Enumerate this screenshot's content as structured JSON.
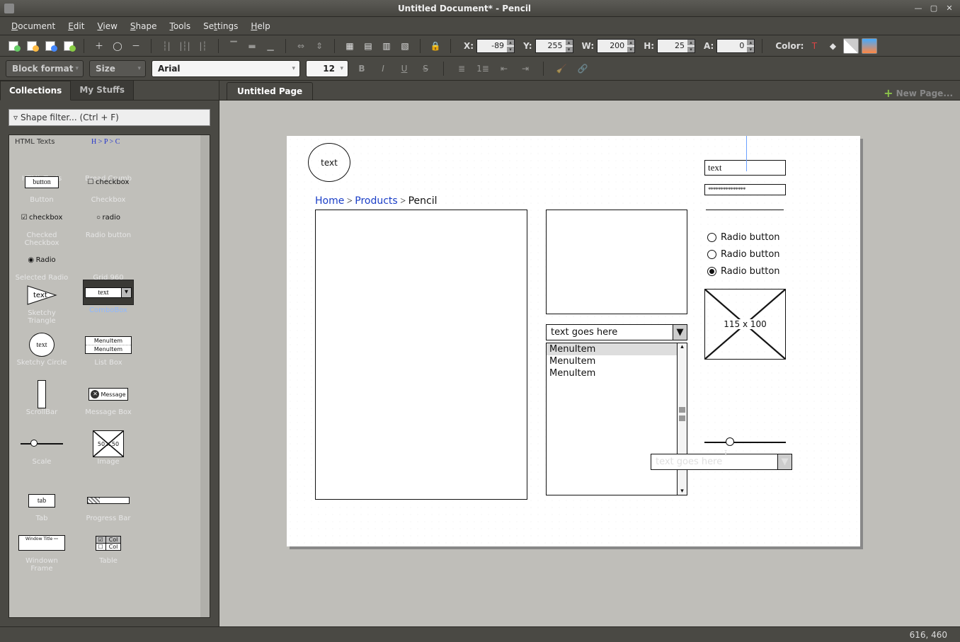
{
  "window": {
    "title": "Untitled Document* - Pencil"
  },
  "menus": [
    "Document",
    "Edit",
    "View",
    "Shape",
    "Tools",
    "Settings",
    "Help"
  ],
  "props": {
    "x_label": "X:",
    "x": "-89",
    "y_label": "Y:",
    "y": "255",
    "w_label": "W:",
    "w": "200",
    "h_label": "H:",
    "h": "25",
    "a_label": "A:",
    "a": "0",
    "color_label": "Color:"
  },
  "format": {
    "block": "Block format",
    "size": "Size",
    "font": "Arial",
    "fontsize": "12"
  },
  "sidebar": {
    "tabs": [
      "Collections",
      "My Stuffs"
    ],
    "filter_placeholder": "Shape filter... (Ctrl + F)",
    "cat1": "HTML Texts",
    "breadcrumb_sample": "H > P > C",
    "shapes": {
      "html_texts": "HTML Texts",
      "bread_crumb": "Bread Crumb",
      "button": "Button",
      "button_thumb": "button",
      "checkbox": "Checkbox",
      "checkbox_thumb": "checkbox",
      "checked_checkbox": "Checked Checkbox",
      "radio_button": "Radio button",
      "radio_thumb": "radio",
      "selected_radio": "Selected Radio",
      "selected_radio_thumb": "Radio",
      "grid960": "Grid 960",
      "sketchy_triangle": "Sketchy Triangle",
      "triangle_thumb": "text",
      "combobox": "ComboBox",
      "combobox_thumb": "text",
      "sketchy_circle": "Sketchy Circle",
      "circle_thumb": "text",
      "list_box": "List Box",
      "list_thumb_1": "MenuItem",
      "list_thumb_2": "MenuItem",
      "scrollbar": "ScrollBar",
      "message_box": "Message Box",
      "message_thumb": "Message",
      "scale": "Scale",
      "image": "Image",
      "image_thumb": "50 x 50",
      "tab": "Tab",
      "tab_thumb": "tab",
      "progress_bar": "Progress Bar",
      "window_frame": "Windown Frame",
      "window_thumb": "Window Title",
      "table": "Table",
      "table_col": "Col"
    }
  },
  "pagetab": "Untitled Page",
  "newpage": "New Page...",
  "canvas": {
    "circle_text": "text",
    "bc_home": "Home",
    "bc_products": "Products",
    "bc_leaf": "Pencil",
    "input_text": "text",
    "password": "***************",
    "radio1": "Radio button",
    "radio2": "Radio button",
    "radio3": "Radio button",
    "img_label": "115 x 100",
    "combo1": "text goes here",
    "menu1": "MenuItem",
    "menu2": "MenuItem",
    "menu3": "MenuItem",
    "floating_combo": "text goes here"
  },
  "status": "616, 460"
}
